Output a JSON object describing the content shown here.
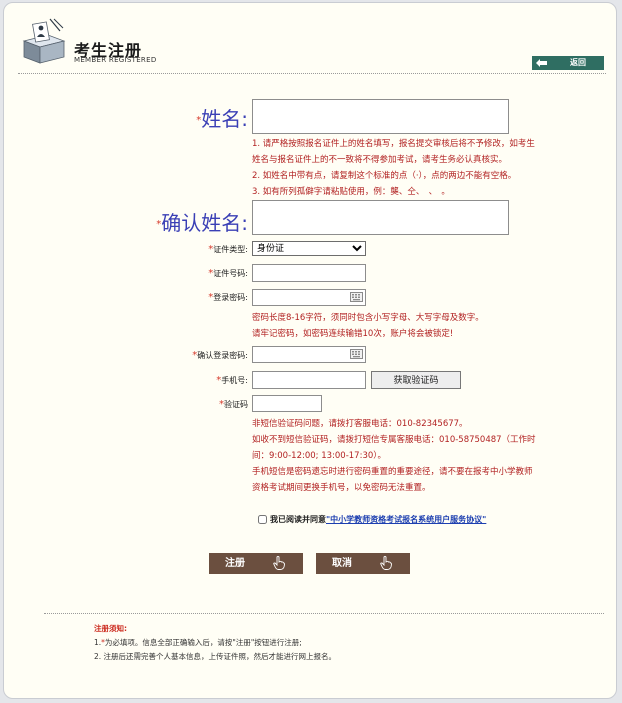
{
  "header": {
    "title": "考生注册",
    "subtitle": "MEMBER REGISTERED",
    "back_label": "返回"
  },
  "form": {
    "star": "*",
    "name_label": "姓名:",
    "name_notes": [
      "1. 请严格按照报名证件上的姓名填写，报名提交审核后将不予修改，如考生",
      "姓名与报名证件上的不一致将不得参加考试，请考生务必认真核实。",
      "2. 如姓名中带有点，请复制这个标准的点（·），点的两边不能有空格。",
      "3. 如有所列孤僻字请粘贴使用，例：龑、仝、　、　。"
    ],
    "confirm_name_label": "确认姓名:",
    "id_type_label": "证件类型:",
    "id_type_value": "身份证",
    "id_number_label": "证件号码:",
    "password_label": "登录密码:",
    "password_notes": [
      "密码长度8-16字符，须同时包含小写字母、大写字母及数字。",
      "请牢记密码，如密码连续输错10次，账户将会被锁定!"
    ],
    "confirm_password_label": "确认登录密码:",
    "phone_label": "手机号:",
    "get_code_label": "获取验证码",
    "code_label": "验证码",
    "code_notes": [
      "非短信验证码问题，请拨打客服电话：010-82345677。",
      "如收不到短信验证码，请拨打短信专属客服电话：010-58750487（工作时",
      "间：9:00-12:00; 13:00-17:30）。",
      "手机短信是密码遗忘时进行密码重置的重要途径，请不要在报考中小学教师",
      "资格考试期间更换手机号，以免密码无法重置。"
    ],
    "agree_text": "我已阅读并同意",
    "agree_link": "\"中小学教师资格考试报名系统用户服务协议\"",
    "register_label": "注册",
    "cancel_label": "取消"
  },
  "notice": {
    "title": "注册须知:",
    "item1_prefix": "1.",
    "item1_star": "*",
    "item1_text": "为必填项。信息全部正确输入后，请按\"注册\"按钮进行注册;",
    "item2_text": "2. 注册后还需完善个人基本信息，上传证件照，然后才能进行网上报名。"
  },
  "colors": {
    "accent_blue": "#3a3fb5",
    "note_red": "#b22222",
    "button_brown": "#6b4f3f",
    "back_green": "#2f6e62"
  }
}
